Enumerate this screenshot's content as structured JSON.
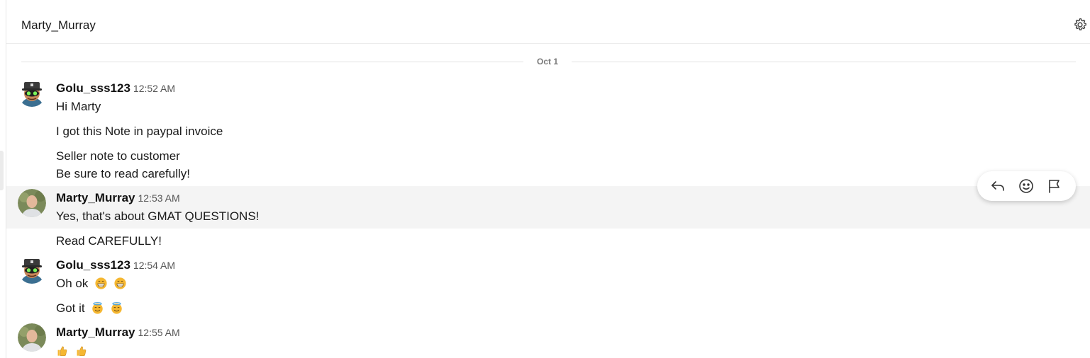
{
  "header": {
    "title": "Marty_Murray",
    "settings_icon": "gear-icon"
  },
  "date_separator": "Oct 1",
  "messages": [
    {
      "author": "Golu_sss123",
      "time": "12:52 AM",
      "avatar": "cartoon-avatar",
      "lines": [
        "Hi Marty",
        "I got this Note in paypal invoice",
        "Seller note to customer",
        "Be sure to read carefully!"
      ]
    },
    {
      "author": "Marty_Murray",
      "time": "12:53 AM",
      "avatar": "photo-avatar",
      "highlighted": true,
      "lines": [
        "Yes, that's about GMAT QUESTIONS!",
        "Read CAREFULLY!"
      ]
    },
    {
      "author": "Golu_sss123",
      "time": "12:54 AM",
      "avatar": "cartoon-avatar",
      "lines": [
        "Oh ok",
        "Got it"
      ],
      "emojis": [
        [
          "grinning-face-emoji",
          "grinning-face-emoji"
        ],
        [
          "smiling-face-with-halo-emoji",
          "smiling-face-with-halo-emoji"
        ]
      ]
    },
    {
      "author": "Marty_Murray",
      "time": "12:55 AM",
      "avatar": "photo-avatar",
      "emojis": [
        [
          "thumbs-up-emoji",
          "thumbs-up-emoji"
        ]
      ]
    }
  ],
  "hover_actions": [
    "reply-icon",
    "emoji-reaction-icon",
    "flag-icon"
  ],
  "colors": {
    "background": "#ffffff",
    "hover_row": "#f4f4f4",
    "text": "#1a1a1a",
    "divider": "#e3e3e3",
    "emoji": "#f5b731"
  }
}
